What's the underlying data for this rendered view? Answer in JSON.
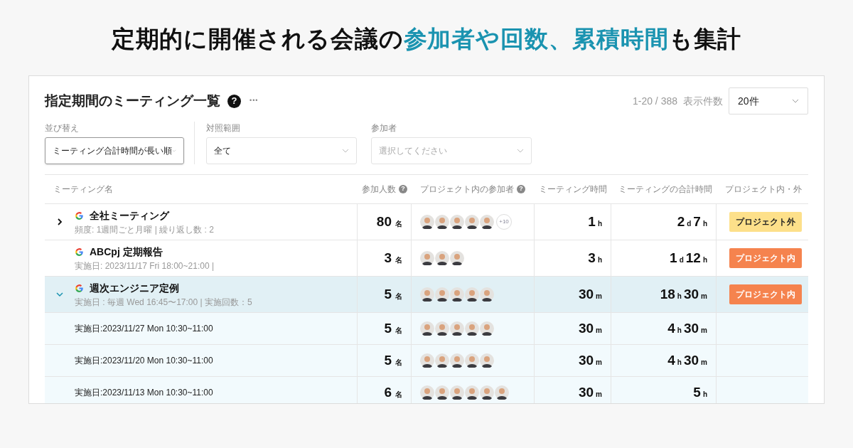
{
  "headline": [
    {
      "text": "定期的に開催される会議の",
      "highlight": false
    },
    {
      "text": "参加者や回数、累積時間",
      "highlight": true
    },
    {
      "text": "も集計",
      "highlight": false
    }
  ],
  "card": {
    "title": "指定期間のミーティング一覧",
    "help": "?",
    "more": "•••",
    "range": "1-20 / 388",
    "per_page_label": "表示件数",
    "per_page": "20件"
  },
  "filters": [
    {
      "label": "並び替え",
      "value": "ミーティング合計時間が長い順",
      "focused": true
    },
    {
      "label": "対照範囲",
      "value": "全て",
      "focused": false
    },
    {
      "label": "参加者",
      "placeholder": "選択してください",
      "focused": false
    }
  ],
  "table": {
    "columns": [
      {
        "label": "ミーティング名",
        "help": false
      },
      {
        "label": "参加人数",
        "help": true
      },
      {
        "label": "プロジェクト内の参加者",
        "help": true
      },
      {
        "label": "ミーティング時間",
        "help": false
      },
      {
        "label": "ミーティングの合計時間",
        "help": false
      },
      {
        "label": "プロジェクト内・外",
        "help": false
      }
    ],
    "rows": [
      {
        "kind": "meeting",
        "expanded": false,
        "selected": false,
        "name": "全社ミーティング",
        "sub": "頻度: 1週間ごと月曜 | 繰り返し数 : 2",
        "count": "80",
        "count_unit": "名",
        "avatars": [
          {
            "kind": "person"
          },
          {
            "kind": "person"
          },
          {
            "kind": "person"
          },
          {
            "kind": "person"
          },
          {
            "kind": "person"
          }
        ],
        "more": "+10",
        "duration": [
          {
            "value": "1",
            "unit": "h"
          }
        ],
        "total": [
          {
            "value": "2",
            "unit": "d"
          },
          {
            "value": "7",
            "unit": "h"
          }
        ],
        "tag": {
          "text": "プロジェクト外",
          "color": "#fde08a"
        }
      },
      {
        "kind": "meeting",
        "selected": false,
        "name": "ABCpj 定期報告",
        "sub": "実施日: 2023/11/17 Fri 18:00~21:00 |",
        "count": "3",
        "count_unit": "名",
        "avatars": [
          {
            "kind": "person"
          },
          {
            "kind": "person"
          },
          {
            "kind": "person"
          }
        ],
        "duration": [
          {
            "value": "3",
            "unit": "h"
          }
        ],
        "total": [
          {
            "value": "1",
            "unit": "d"
          },
          {
            "value": "12",
            "unit": "h"
          }
        ],
        "tag": {
          "text": "プロジェクト内",
          "color": "#f5834e"
        }
      },
      {
        "kind": "meeting",
        "expanded": true,
        "selected": true,
        "name": "週次エンジニア定例",
        "sub": "実施日 : 毎週 Wed 16:45〜17:00 | 実施回数：5",
        "count": "5",
        "count_unit": "名",
        "avatars": [
          {
            "kind": "person"
          },
          {
            "kind": "person"
          },
          {
            "kind": "person"
          },
          {
            "kind": "person"
          },
          {
            "kind": "person"
          }
        ],
        "duration": [
          {
            "value": "30",
            "unit": "m"
          }
        ],
        "total": [
          {
            "value": "18",
            "unit": "h"
          },
          {
            "value": "30",
            "unit": "m"
          }
        ],
        "tag": {
          "text": "プロジェクト内",
          "color": "#f5834e"
        }
      },
      {
        "kind": "occurrence",
        "name": "実施日:2023/11/27 Mon 10:30~11:00",
        "count": "5",
        "count_unit": "名",
        "avatars": [
          {
            "kind": "person"
          },
          {
            "kind": "person"
          },
          {
            "kind": "person"
          },
          {
            "kind": "person"
          },
          {
            "kind": "person"
          }
        ],
        "duration": [
          {
            "value": "30",
            "unit": "m"
          }
        ],
        "total": [
          {
            "value": "4",
            "unit": "h"
          },
          {
            "value": "30",
            "unit": "m"
          }
        ]
      },
      {
        "kind": "occurrence",
        "name": "実施日:2023/11/20 Mon 10:30~11:00",
        "count": "5",
        "count_unit": "名",
        "avatars": [
          {
            "kind": "person"
          },
          {
            "kind": "person"
          },
          {
            "kind": "person"
          },
          {
            "kind": "person"
          },
          {
            "kind": "person"
          }
        ],
        "duration": [
          {
            "value": "30",
            "unit": "m"
          }
        ],
        "total": [
          {
            "value": "4",
            "unit": "h"
          },
          {
            "value": "30",
            "unit": "m"
          }
        ]
      },
      {
        "kind": "occurrence",
        "name": "実施日:2023/11/13 Mon 10:30~11:00",
        "count": "6",
        "count_unit": "名",
        "avatars": [
          {
            "kind": "person"
          },
          {
            "kind": "person"
          },
          {
            "kind": "person"
          },
          {
            "kind": "person"
          },
          {
            "kind": "person"
          },
          {
            "kind": "person"
          }
        ],
        "duration": [
          {
            "value": "30",
            "unit": "m"
          }
        ],
        "total": [
          {
            "value": "5",
            "unit": "h"
          }
        ]
      }
    ]
  }
}
